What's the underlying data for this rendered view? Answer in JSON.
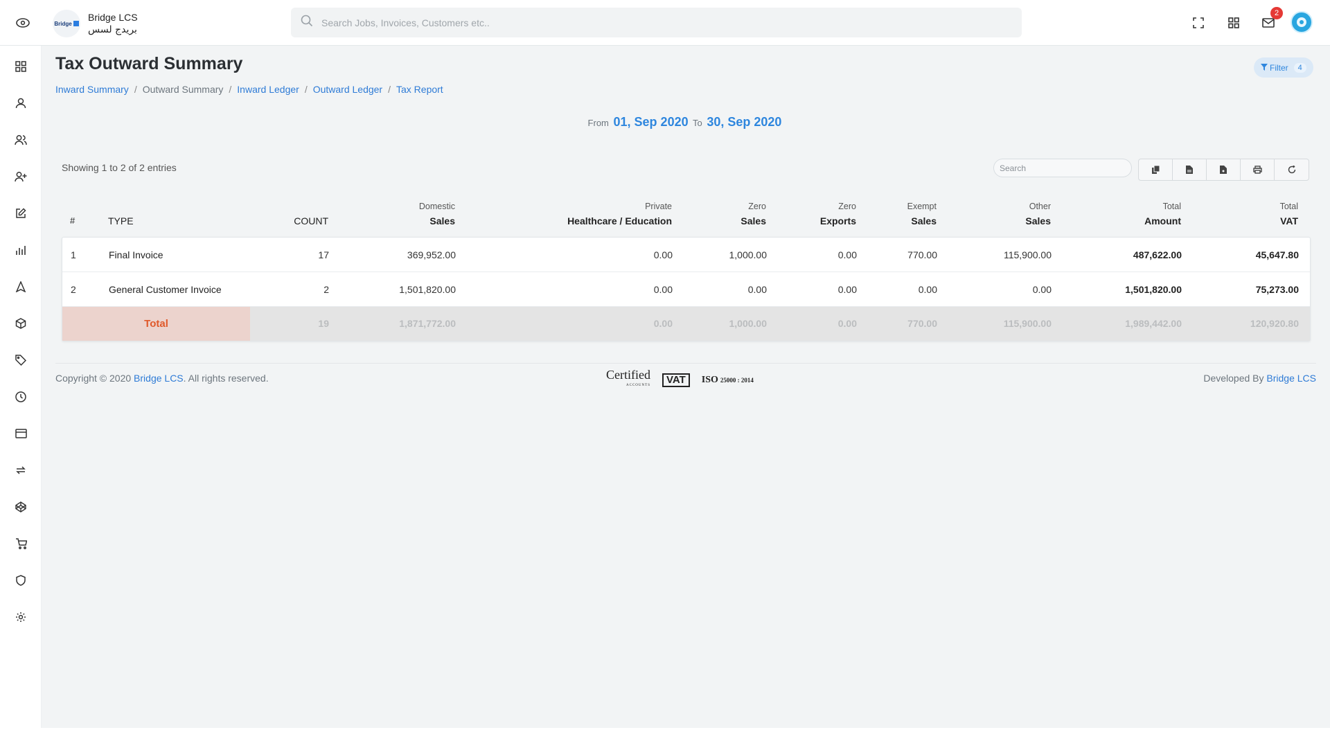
{
  "brand": {
    "name": "Bridge LCS",
    "arabic": "بريدج لسس",
    "logo_text": "Bridge"
  },
  "search": {
    "placeholder": "Search Jobs, Invoices, Customers etc.."
  },
  "header": {
    "notifications_count": "2"
  },
  "page": {
    "title": "Tax Outward Summary",
    "filter_label": "Filter",
    "filter_count": "4"
  },
  "breadcrumb": [
    {
      "label": "Inward Summary"
    },
    {
      "label": "Outward Summary"
    },
    {
      "label": "Inward Ledger"
    },
    {
      "label": "Outward Ledger"
    },
    {
      "label": "Tax Report"
    }
  ],
  "date_range": {
    "from_label": "From",
    "from": "01, Sep 2020",
    "to_label": "To",
    "to": "30, Sep 2020"
  },
  "table": {
    "showing": "Showing 1 to 2 of 2 entries",
    "search_placeholder": "Search",
    "columns": [
      {
        "top": "",
        "bottom": "#"
      },
      {
        "top": "",
        "bottom": "TYPE"
      },
      {
        "top": "",
        "bottom": "COUNT"
      },
      {
        "top": "Domestic",
        "bottom": "Sales"
      },
      {
        "top": "Private",
        "bottom": "Healthcare / Education"
      },
      {
        "top": "Zero",
        "bottom": "Sales"
      },
      {
        "top": "Zero",
        "bottom": "Exports"
      },
      {
        "top": "Exempt",
        "bottom": "Sales"
      },
      {
        "top": "Other",
        "bottom": "Sales"
      },
      {
        "top": "Total",
        "bottom": "Amount"
      },
      {
        "top": "Total",
        "bottom": "VAT"
      }
    ],
    "rows": [
      {
        "num": "1",
        "type": "Final Invoice",
        "count": "17",
        "domestic": "369,952.00",
        "private": "0.00",
        "zero_sales": "1,000.00",
        "zero_exports": "0.00",
        "exempt": "770.00",
        "other": "115,900.00",
        "total_amount": "487,622.00",
        "total_vat": "45,647.80"
      },
      {
        "num": "2",
        "type": "General Customer Invoice",
        "count": "2",
        "domestic": "1,501,820.00",
        "private": "0.00",
        "zero_sales": "0.00",
        "zero_exports": "0.00",
        "exempt": "0.00",
        "other": "0.00",
        "total_amount": "1,501,820.00",
        "total_vat": "75,273.00"
      }
    ],
    "total": {
      "label": "Total",
      "count": "19",
      "domestic": "1,871,772.00",
      "private": "0.00",
      "zero_sales": "1,000.00",
      "zero_exports": "0.00",
      "exempt": "770.00",
      "other": "115,900.00",
      "total_amount": "1,989,442.00",
      "total_vat": "120,920.80"
    }
  },
  "footer": {
    "copyright_prefix": "Copyright © 2020",
    "company": "Bridge LCS",
    "rights": ". All rights reserved.",
    "developed_by": "Developed By",
    "developer": "Bridge LCS",
    "cert_certified": "Certified",
    "cert_accounts": "ACCOUNTS",
    "cert_vat": "VAT",
    "cert_iso": "ISO",
    "cert_iso_num": "25000 : 2014"
  },
  "colors": {
    "accent": "#2e86de",
    "total_label": "#e0592a",
    "total_bg": "#ecd3cd",
    "badge": "#e53935"
  },
  "sidebar_icons": [
    "dashboard-icon",
    "user-icon",
    "users-icon",
    "user-plus-icon",
    "edit-icon",
    "chart-icon",
    "navigation-icon",
    "box-icon",
    "tag-icon",
    "clock-icon",
    "card-icon",
    "refresh-icon",
    "codepen-icon",
    "cart-icon",
    "shield-icon",
    "gear-icon"
  ]
}
